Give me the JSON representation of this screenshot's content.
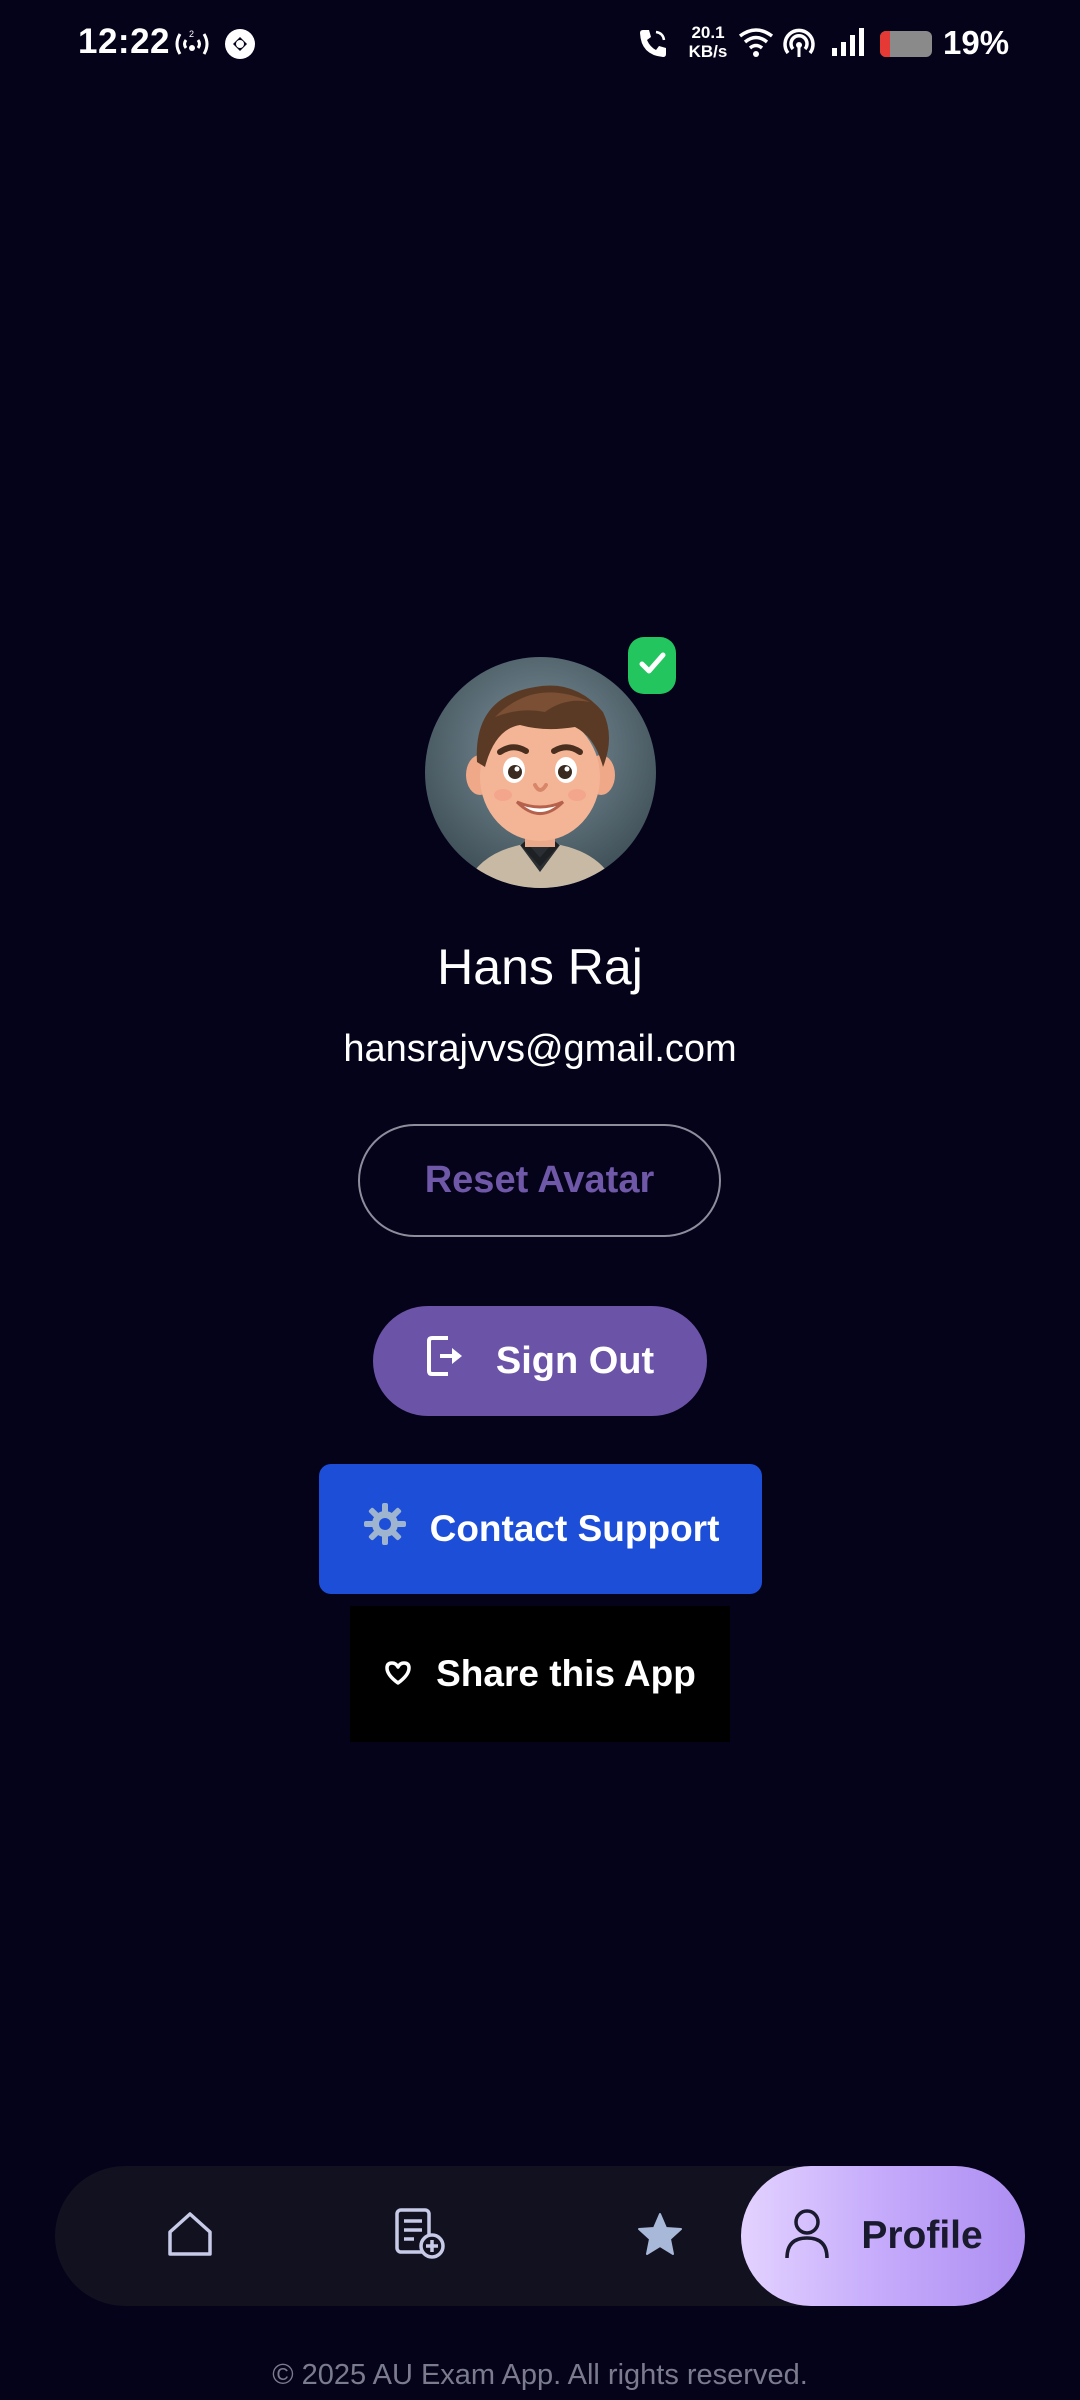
{
  "status_bar": {
    "time": "12:22",
    "net_speed_value": "20.1",
    "net_speed_unit": "KB/s",
    "battery_percent": "19%",
    "battery_level": 0.19,
    "icons": [
      "signal-2-icon",
      "data-saver-icon",
      "call-icon",
      "wifi-icon",
      "hotspot-icon",
      "cell-signal-icon",
      "battery-icon"
    ]
  },
  "profile": {
    "name": "Hans Raj",
    "email": "hansrajvvs@gmail.com",
    "verified_icon": "check-icon"
  },
  "actions": {
    "reset_avatar": "Reset Avatar",
    "sign_out": "Sign Out",
    "contact_support": "Contact Support",
    "share_app": "Share this App"
  },
  "bottom_nav": {
    "items": [
      {
        "icon": "home-icon"
      },
      {
        "icon": "exam-add-icon"
      },
      {
        "icon": "star-icon"
      },
      {
        "icon": "person-icon",
        "label": "Profile",
        "active": true
      }
    ]
  },
  "footer": "© 2025 AU Exam App. All rights reserved.",
  "colors": {
    "background": "#05031a",
    "accent_purple": "#6b53a8",
    "support_blue": "#1d4ed8",
    "verified_green": "#22c55e",
    "nav_active_gradient": [
      "#e3d2ff",
      "#ad8ef2"
    ]
  }
}
